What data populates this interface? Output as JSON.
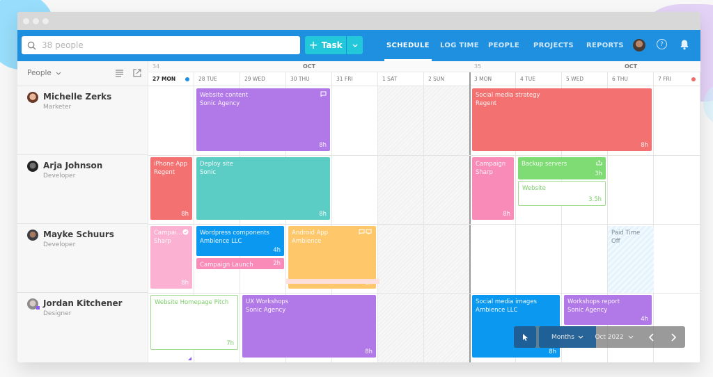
{
  "header": {
    "search_placeholder": "38 people",
    "task_button_label": "Task",
    "nav": [
      {
        "label": "SCHEDULE",
        "active": true
      },
      {
        "label": "LOG TIME",
        "active": false
      },
      {
        "label": "PEOPLE",
        "active": false
      },
      {
        "label": "PROJECTS",
        "active": false
      },
      {
        "label": "REPORTS",
        "active": false
      }
    ],
    "help_glyph": "?"
  },
  "sidebar": {
    "filter_label": "People",
    "people": [
      {
        "name": "Michelle Zerks",
        "role": "Marketer"
      },
      {
        "name": "Arja Johnson",
        "role": "Developer"
      },
      {
        "name": "Mayke Schuurs",
        "role": "Developer"
      },
      {
        "name": "Jordan Kitchener",
        "role": "Designer"
      }
    ]
  },
  "calendar": {
    "weeks": [
      {
        "number": "34",
        "month": "OCT"
      },
      {
        "number": "35",
        "month": "OCT"
      }
    ],
    "days": [
      {
        "label": "27 MON",
        "today": true
      },
      {
        "label": "28 TUE"
      },
      {
        "label": "29 WED"
      },
      {
        "label": "30 THU"
      },
      {
        "label": "31 FRI"
      },
      {
        "label": "1 SAT",
        "weekend": true
      },
      {
        "label": "2 SUN",
        "weekend": true
      },
      {
        "label": "3 MON"
      },
      {
        "label": "4 TUE"
      },
      {
        "label": "5 WED"
      },
      {
        "label": "6 THU"
      },
      {
        "label": "7 FRI",
        "flag": true
      }
    ],
    "tasks": [
      {
        "title": "Website content",
        "client": "Sonic Agency",
        "hours": "8h",
        "color": "#b178e8",
        "icon": "comment-icon"
      },
      {
        "title": "Social media strategy",
        "client": "Regent",
        "hours": "8h",
        "color": "#f47171"
      },
      {
        "title": "iPhone App",
        "client": "Regent",
        "hours": "8h",
        "color": "#f47171"
      },
      {
        "title": "Deploy site",
        "client": "Sonic",
        "hours": "8h",
        "color": "#5ccdc5"
      },
      {
        "title": "Campaign",
        "client": "Sharp",
        "hours": "8h",
        "color": "#f88bb8"
      },
      {
        "title": "Backup servers",
        "client": "",
        "hours": "3h",
        "color": "#7fdc74",
        "icon": "repeat-icon"
      },
      {
        "title": "Website",
        "client": "",
        "hours": "3.5h",
        "color": "#7ccc68",
        "outline": true
      },
      {
        "title": "Campai…",
        "client": "Sharp",
        "hours": "8h",
        "color": "#fbb2d2",
        "icon": "check-icon"
      },
      {
        "title": "Wordpress components",
        "client": "Ambience LLC",
        "hours": "4h",
        "color": "#0b98f0"
      },
      {
        "title": "Campaign Launch",
        "client": "",
        "hours": "2h",
        "color": "#f88bb8"
      },
      {
        "title": "Android App",
        "client": "Ambience",
        "hours": "8h",
        "color": "#fdc76a",
        "icon": "comments-icon"
      },
      {
        "title": "Paid Time Off",
        "client": "",
        "hours": "",
        "pto": true
      },
      {
        "title": "Website Homepage Pitch",
        "client": "",
        "hours": "7h",
        "color": "#7ccc68",
        "outline": true
      },
      {
        "title": "UX Workshops",
        "client": "Sonic Agency",
        "hours": "8h",
        "color": "#b178e8"
      },
      {
        "title": "Social media images",
        "client": "Ambience LLC",
        "hours": "8h",
        "color": "#0b98f0"
      },
      {
        "title": "Workshops report",
        "client": "Sonic Agency",
        "hours": "4h",
        "color": "#b178e8"
      }
    ]
  },
  "toolbar": {
    "view_label": "Months",
    "period_label": "Oct 2022"
  },
  "colors": {
    "brand": "#1e90df",
    "accent": "#22c7d9"
  }
}
